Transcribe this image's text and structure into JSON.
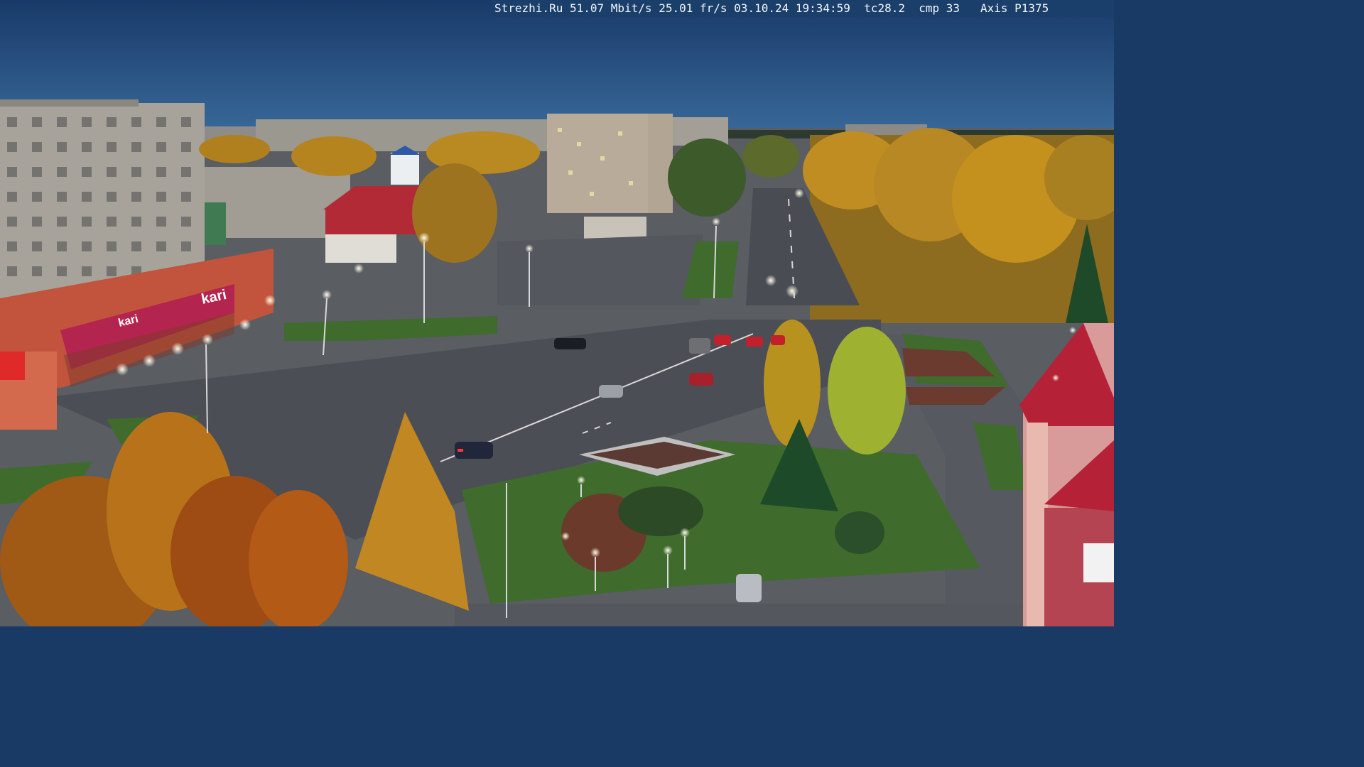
{
  "overlay": {
    "site": "Strezhi.Ru",
    "bitrate": "51.07 Mbit/s",
    "framerate": "25.01 fr/s",
    "date": "03.10.24",
    "time": "19:34:59",
    "tc": "tc28.2",
    "cmp": "cmp 33",
    "camera": "Axis P1375"
  },
  "signs": {
    "store_name": "kari",
    "store_name_2": "kari"
  },
  "colors": {
    "sky_top": "#1b3d6d",
    "sky_bottom": "#33689a",
    "road": "#4f5159",
    "grass": "#3f6b2c",
    "autumn": "#c58a1c",
    "brick": "#c2543d",
    "red_roof": "#b52238"
  }
}
